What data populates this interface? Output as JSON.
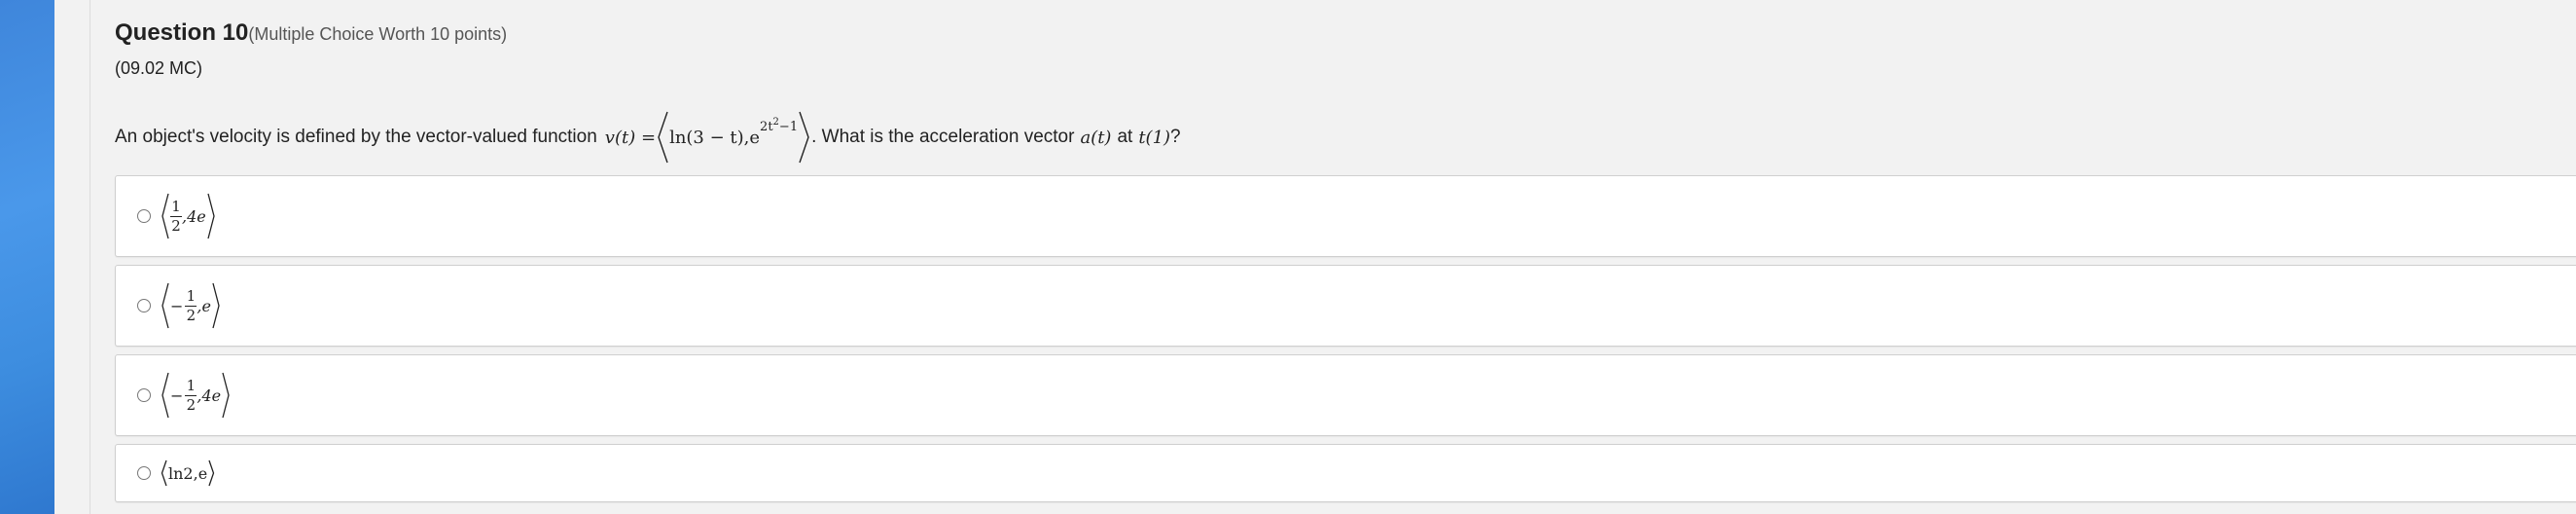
{
  "question": {
    "title": "Question 10",
    "worth": "(Multiple Choice Worth 10 points)",
    "code": "(09.02 MC)",
    "prompt_before": "An object's velocity is defined by the vector-valued function",
    "prompt_after": ". What is the acceleration vector",
    "prompt_at": "at",
    "prompt_end": "?",
    "math": {
      "v_of_t": "v(t) =",
      "component1": "ln(3 − t),",
      "e": "e",
      "exponent_base": "2t",
      "exponent_power": "2",
      "exponent_tail": "−1",
      "a_of_t": "a(t)",
      "t_of_1": "t(1)"
    }
  },
  "options": [
    {
      "numerator": "1",
      "denominator": "2",
      "neg": "",
      "second": ",4e"
    },
    {
      "numerator": "1",
      "denominator": "2",
      "neg": "−",
      "second": ",e"
    },
    {
      "numerator": "1",
      "denominator": "2",
      "neg": "−",
      "second": ",4e"
    },
    {
      "text": "ln2,e"
    }
  ],
  "colors": {
    "sidebar_accent": "#4a98ea",
    "background": "#f2f2f2"
  }
}
